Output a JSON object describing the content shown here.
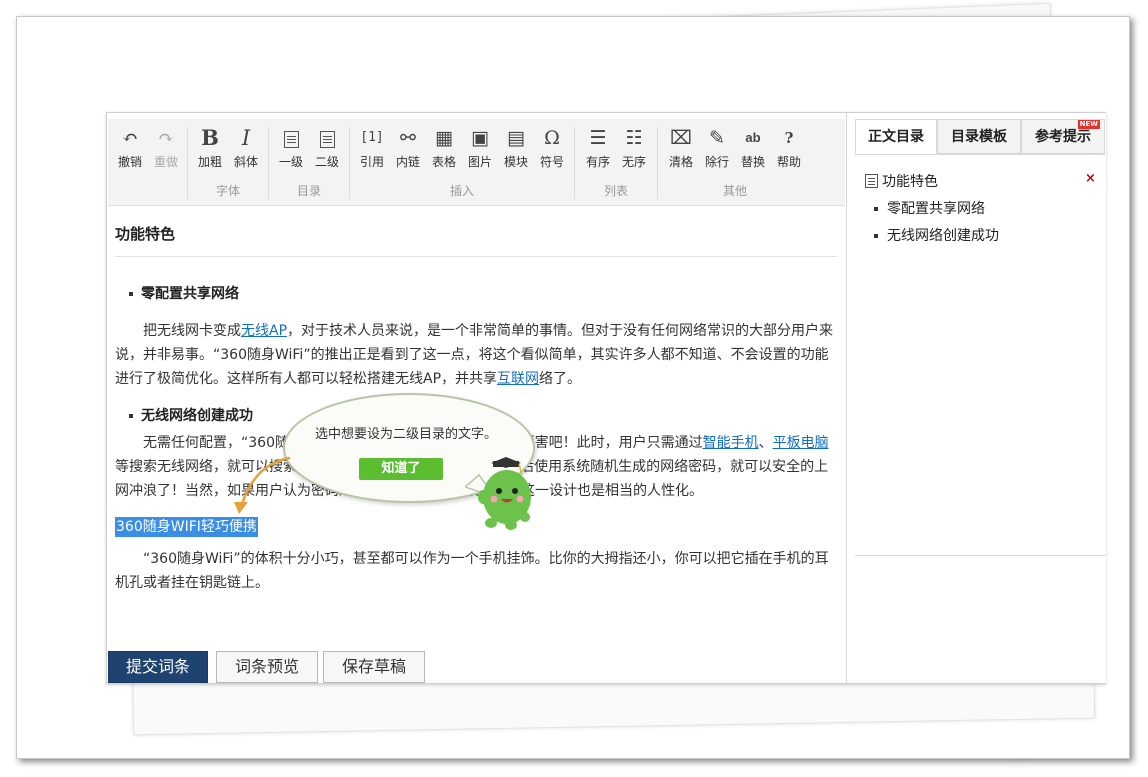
{
  "toolbar": {
    "buttons": [
      {
        "label": "撤销",
        "icon": "undo-icon",
        "glyph": "↶"
      },
      {
        "label": "重做",
        "icon": "redo-icon",
        "glyph": "↷"
      },
      {
        "label": "加粗",
        "icon": "bold-icon",
        "glyph": "B"
      },
      {
        "label": "斜体",
        "icon": "italic-icon",
        "glyph": "I"
      },
      {
        "label": "一级",
        "icon": "heading-level1-icon",
        "glyph": ""
      },
      {
        "label": "二级",
        "icon": "heading-level2-icon",
        "glyph": ""
      },
      {
        "label": "引用",
        "icon": "quote-icon",
        "glyph": "[1]"
      },
      {
        "label": "内链",
        "icon": "link-icon",
        "glyph": "⚯"
      },
      {
        "label": "表格",
        "icon": "table-icon",
        "glyph": "▦"
      },
      {
        "label": "图片",
        "icon": "image-icon",
        "glyph": "▣"
      },
      {
        "label": "模块",
        "icon": "module-icon",
        "glyph": "▤"
      },
      {
        "label": "符号",
        "icon": "symbol-icon",
        "glyph": "Ω"
      },
      {
        "label": "有序",
        "icon": "ordered-list-icon",
        "glyph": "☰"
      },
      {
        "label": "无序",
        "icon": "unordered-list-icon",
        "glyph": "☷"
      },
      {
        "label": "清格",
        "icon": "clear-format-icon",
        "glyph": "⌧"
      },
      {
        "label": "除行",
        "icon": "remove-lines-icon",
        "glyph": "✎"
      },
      {
        "label": "替换",
        "icon": "replace-icon",
        "glyph": "ab"
      },
      {
        "label": "帮助",
        "icon": "help-icon",
        "glyph": "?"
      }
    ],
    "groups": [
      "字体",
      "目录",
      "插入",
      "列表",
      "其他"
    ]
  },
  "article": {
    "title": "功能特色",
    "sections": [
      {
        "heading": "零配置共享网络",
        "paragraph": {
          "t1": "把无线网卡变成",
          "link1": "无线AP",
          "t2": "，对于技术人员来说，是一个非常简单的事情。但对于没有任何网络常识的大部分用户来说，并非易事。“360随身WiFi”的推出正是看到了这一点，将这个看似简单，其实许多人都不知道、不会设置的功能进行了极简优化。这样所有人都可以轻松搭建无线AP，并共享",
          "link2": "互联网",
          "t3": "络了。"
        }
      },
      {
        "heading": "无线网络创建成功",
        "paragraph": {
          "t1": "无需任何配置，“360随身WiFi”插上电脑就能创建无线网络，厉害吧！此时，用户只需通过",
          "link1": "智能手机",
          "sep": "、",
          "link2": "平板电脑",
          "t2": "等搜索无线网络，就可以搜索到360随身WiFi创建的无线网络，然后使用系统随机生成的网络密码，就可以安全的上网冲浪了！当然，如果用户认为密码过于复杂，也可以修改密码，这一设计也是相当的人性化。"
        }
      }
    ],
    "selected_text": "360随身WIFI轻巧便携",
    "last_paragraph": "“360随身WiFi”的体积十分小巧，甚至都可以作为一个手机挂饰。比你的大拇指还小，你可以把它插在手机的耳机孔或者挂在钥匙链上。"
  },
  "sidebar": {
    "tabs": [
      {
        "label": "正文目录",
        "active": true
      },
      {
        "label": "目录模板",
        "active": false
      },
      {
        "label": "参考提示",
        "active": false,
        "badge": "NEW"
      }
    ],
    "toc": {
      "root": "功能特色",
      "root_icon": "toc-list-icon",
      "close_glyph": "×",
      "items": [
        "零配置共享网络",
        "无线网络创建成功"
      ]
    }
  },
  "footer": {
    "submit": "提交词条",
    "preview": "词条预览",
    "save_draft": "保存草稿"
  },
  "tooltip": {
    "text": "选中想要设为二级目录的文字。",
    "button": "知道了"
  },
  "colors": {
    "primary_button": "#1f4370",
    "link": "#136ec2",
    "selection": "#3a8ee6",
    "tooltip_button": "#5bbd30",
    "mascot": "#6cc24a"
  }
}
